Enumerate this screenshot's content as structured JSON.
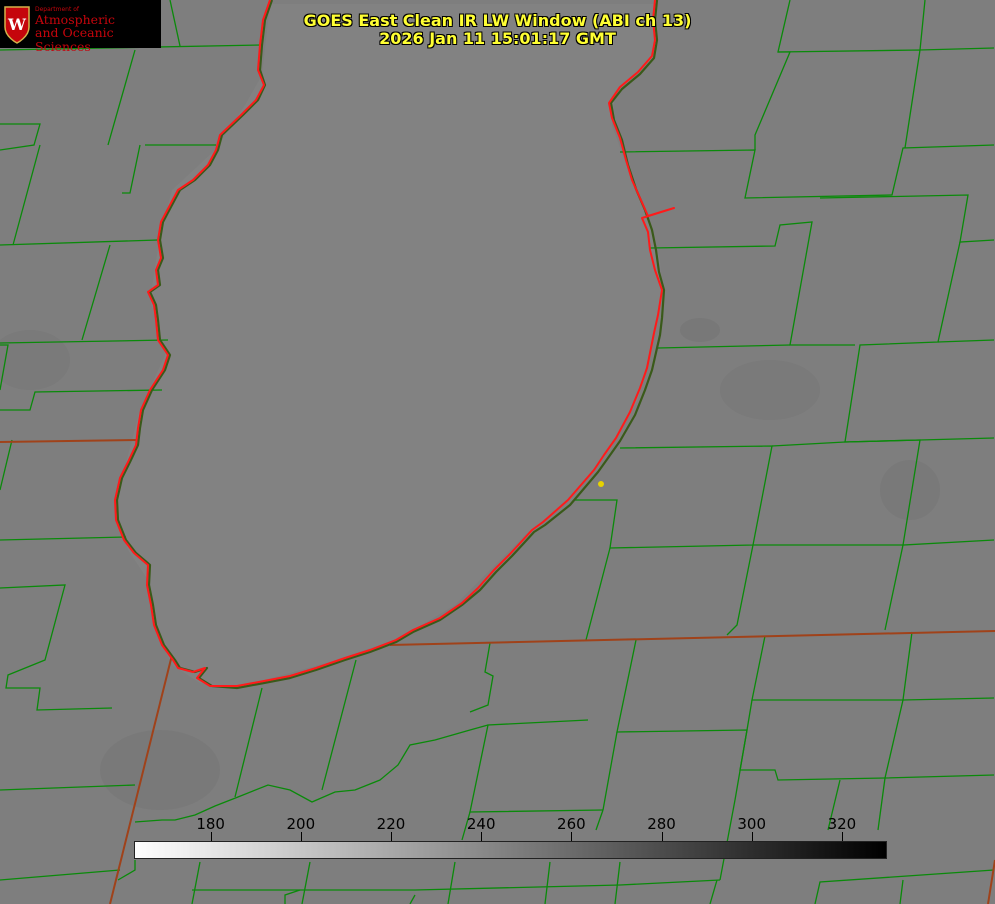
{
  "title": {
    "line1": "GOES East Clean IR LW Window (ABI ch 13)",
    "line2": "2026 Jan 11 15:01:17 GMT"
  },
  "logo": {
    "dept": "Department of",
    "line1": "Atmospheric",
    "line2": "and Oceanic Sciences",
    "crest_letter": "W"
  },
  "colorbar": {
    "ticks": [
      "180",
      "200",
      "220",
      "240",
      "260",
      "280",
      "300",
      "320"
    ],
    "range": [
      163,
      330
    ],
    "colormap": "white-to-black"
  },
  "colors": {
    "background": "#7e7e7e",
    "county_lines": "#0a8a0a",
    "state_lines": "#a0421a",
    "lake_outline": "#ff1a1a",
    "marker": "#e6d200",
    "title": "#ffff33"
  }
}
